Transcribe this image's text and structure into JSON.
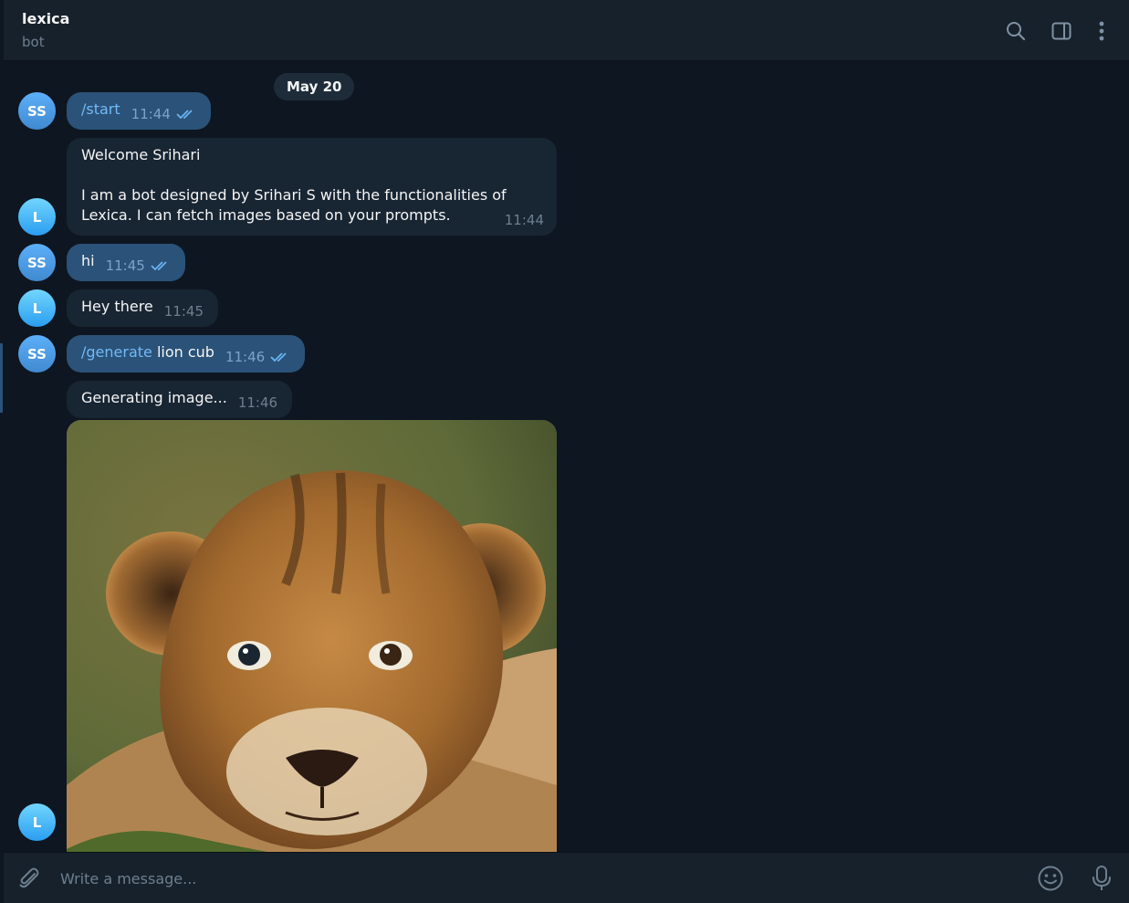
{
  "header": {
    "title": "lexica",
    "subtitle": "bot"
  },
  "date_label": "May 20",
  "avatars": {
    "user": "SS",
    "bot": "L"
  },
  "messages": [
    {
      "command": "/start",
      "text": "",
      "time": "11:44"
    },
    {
      "line1": "Welcome Srihari",
      "line2": "I am a bot designed by Srihari S with the functionalities of Lexica. I can fetch images based on your prompts.",
      "time": "11:44"
    },
    {
      "text": "hi",
      "time": "11:45"
    },
    {
      "text": "Hey there",
      "time": "11:45"
    },
    {
      "command": "/generate",
      "text": " lion cub",
      "time": "11:46"
    },
    {
      "text": "Generating image...",
      "time": "11:46"
    }
  ],
  "composer": {
    "placeholder": "Write a message..."
  },
  "colors": {
    "background": "#0e1621",
    "header": "#17212b",
    "outgoing_bubble": "#2b5278",
    "incoming_bubble": "#182533",
    "link": "#71baf7"
  },
  "icons": [
    "search-icon",
    "sidebar-toggle-icon",
    "more-vertical-icon",
    "paperclip-icon",
    "emoji-icon",
    "microphone-icon",
    "double-check-icon"
  ]
}
